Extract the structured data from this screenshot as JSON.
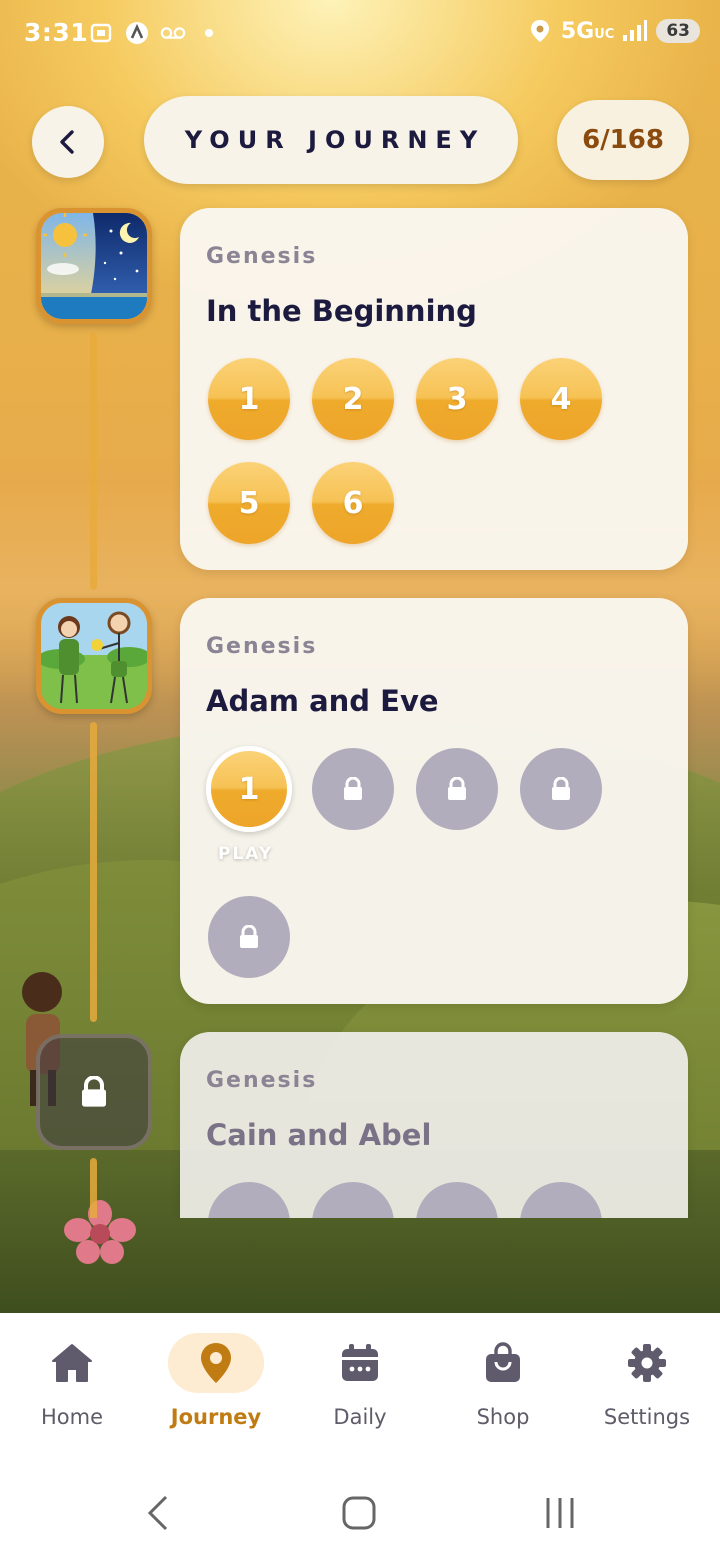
{
  "status_bar": {
    "time": "3:31",
    "network": "5G",
    "network_sub": "UC",
    "battery": "63"
  },
  "header": {
    "title": "YOUR JOURNEY",
    "progress": "6/168"
  },
  "stories": [
    {
      "book": "Genesis",
      "title": "In the Beginning",
      "status": "completed",
      "levels": [
        "1",
        "2",
        "3",
        "4",
        "5",
        "6"
      ]
    },
    {
      "book": "Genesis",
      "title": "Adam and Eve",
      "status": "in-progress",
      "current_level": "1",
      "play_label": "PLAY",
      "locked_levels": 4
    },
    {
      "book": "Genesis",
      "title": "Cain and Abel",
      "status": "locked"
    }
  ],
  "bottom_nav": {
    "items": [
      {
        "label": "Home",
        "icon": "home-icon"
      },
      {
        "label": "Journey",
        "icon": "map-pin-icon",
        "active": true
      },
      {
        "label": "Daily",
        "icon": "calendar-icon"
      },
      {
        "label": "Shop",
        "icon": "shopping-bag-icon"
      },
      {
        "label": "Settings",
        "icon": "gear-icon"
      }
    ]
  },
  "colors": {
    "accent": "#efab2c",
    "active_nav": "#c07c12",
    "title_text": "#1c1a3f",
    "locked": "#b2adbc"
  }
}
